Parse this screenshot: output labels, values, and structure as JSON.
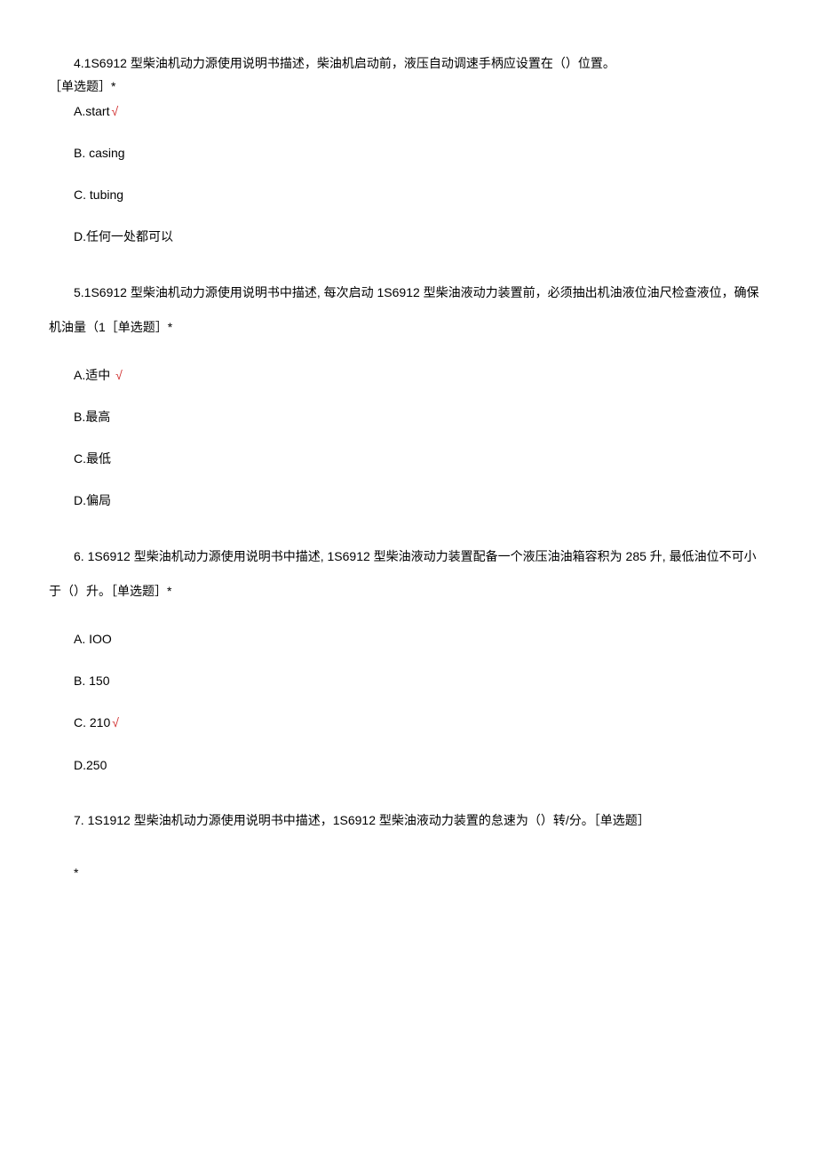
{
  "questions": [
    {
      "number": "4.",
      "stem": "4.1S6912 型柴油机动力源使用说明书描述，柴油机启动前，液压自动调速手柄应设置在（）位置。",
      "tag": "［单选题］*",
      "options": [
        {
          "label": "A.start",
          "correct": true
        },
        {
          "label": "B.   casing",
          "correct": false
        },
        {
          "label": "C.   tubing",
          "correct": false
        },
        {
          "label": "D.任何一处都可以",
          "correct": false
        }
      ]
    },
    {
      "number": "5.",
      "stem": "5.1S6912 型柴油机动力源使用说明书中描述, 每次启动 1S6912 型柴油液动力装置前，必须抽出机油液位油尺检查液位，确保机油量（1［单选题］*",
      "options": [
        {
          "label": "A.适中",
          "correct": true
        },
        {
          "label": "B.最高",
          "correct": false
        },
        {
          "label": "C.最低",
          "correct": false
        },
        {
          "label": "D.偏局",
          "correct": false
        }
      ]
    },
    {
      "number": "6.",
      "stem": "6.   1S6912 型柴油机动力源使用说明书中描述, 1S6912 型柴油液动力装置配备一个液压油油箱容积为 285 升, 最低油位不可小于（）升。［单选题］*",
      "options": [
        {
          "label": "A.   IOO",
          "correct": false
        },
        {
          "label": "B.   150",
          "correct": false
        },
        {
          "label": "C.   210",
          "correct": true
        },
        {
          "label": "D.250",
          "correct": false
        }
      ]
    },
    {
      "number": "7.",
      "stem": "7.   1S1912 型柴油机动力源使用说明书中描述，1S6912 型柴油液动力装置的怠速为（）转/分。［单选题］",
      "trailing": "*"
    }
  ],
  "check_mark": "√"
}
